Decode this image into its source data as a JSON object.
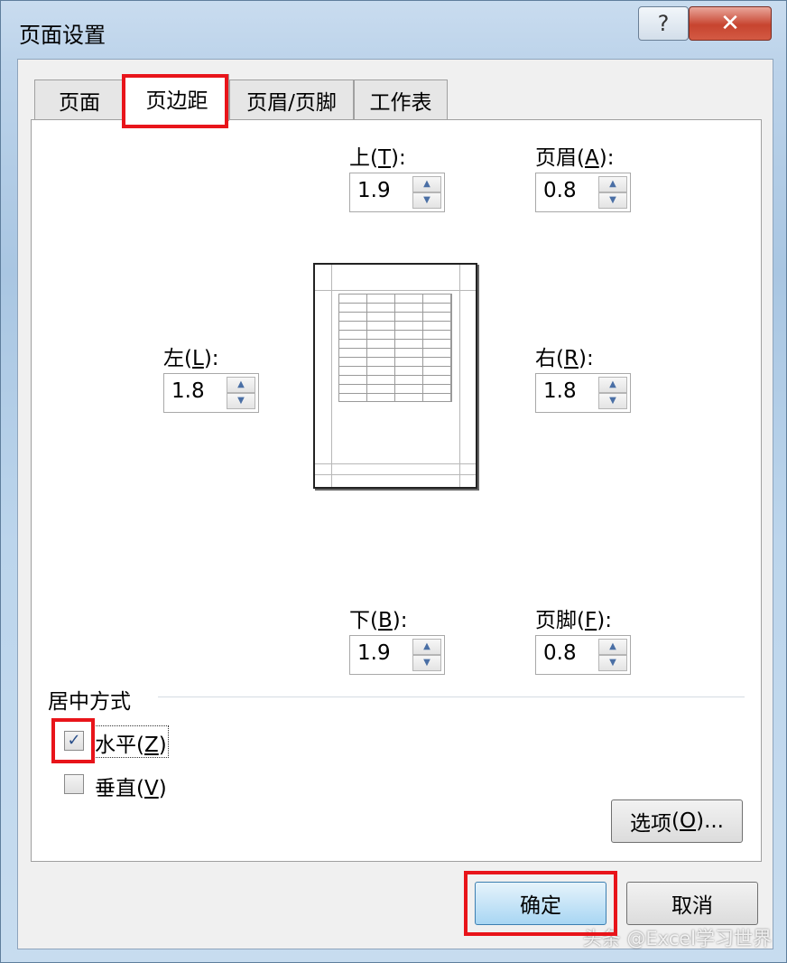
{
  "window": {
    "title": "页面设置",
    "help_glyph": "?",
    "close_glyph": "✕"
  },
  "tabs": [
    {
      "label": "页面"
    },
    {
      "label": "页边距"
    },
    {
      "label": "页眉/页脚"
    },
    {
      "label": "工作表"
    }
  ],
  "margins": {
    "top": {
      "label": "上",
      "key": "T",
      "suffix": ":",
      "value": "1.9"
    },
    "header": {
      "label": "页眉",
      "key": "A",
      "suffix": ":",
      "value": "0.8"
    },
    "left": {
      "label": "左",
      "key": "L",
      "suffix": ":",
      "value": "1.8"
    },
    "right": {
      "label": "右",
      "key": "R",
      "suffix": ":",
      "value": "1.8"
    },
    "bottom": {
      "label": "下",
      "key": "B",
      "suffix": ":",
      "value": "1.9"
    },
    "footer": {
      "label": "页脚",
      "key": "F",
      "suffix": ":",
      "value": "0.8"
    }
  },
  "centering": {
    "title": "居中方式",
    "horizontal": {
      "label": "水平",
      "key": "Z",
      "checked": true
    },
    "vertical": {
      "label": "垂直",
      "key": "V",
      "checked": false
    }
  },
  "buttons": {
    "options": {
      "label": "选项",
      "key": "O",
      "ellipsis": "..."
    },
    "ok": "确定",
    "cancel": "取消"
  },
  "watermark": "头条 @Excel学习世界",
  "colors": {
    "highlight": "#e8141a",
    "accent": "#3c7fb1"
  }
}
